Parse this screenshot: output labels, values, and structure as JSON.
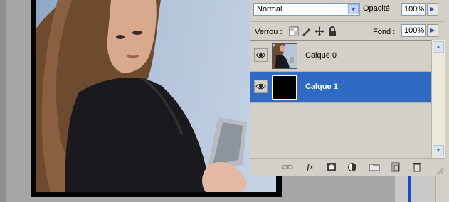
{
  "layers_panel": {
    "blend_mode": "Normal",
    "opacity_label": "Opacité :",
    "opacity_value": "100%",
    "lock_label": "Verrou :",
    "fill_label": "Fond :",
    "fill_value": "100%",
    "layers": [
      {
        "name": "Calque 0",
        "visible": true,
        "selected": false,
        "thumb": "photo"
      },
      {
        "name": "Calque 1",
        "visible": true,
        "selected": true,
        "thumb": "black"
      }
    ],
    "lock_icons": [
      "lock-transparency-icon",
      "lock-pixels-icon",
      "lock-position-icon",
      "lock-all-icon"
    ],
    "bottom_icons": [
      "link-layers-icon",
      "layer-style-icon",
      "layer-mask-icon",
      "adjustment-layer-icon",
      "new-group-icon",
      "new-layer-icon",
      "trash-icon"
    ],
    "selection_color": "#316ac5"
  }
}
